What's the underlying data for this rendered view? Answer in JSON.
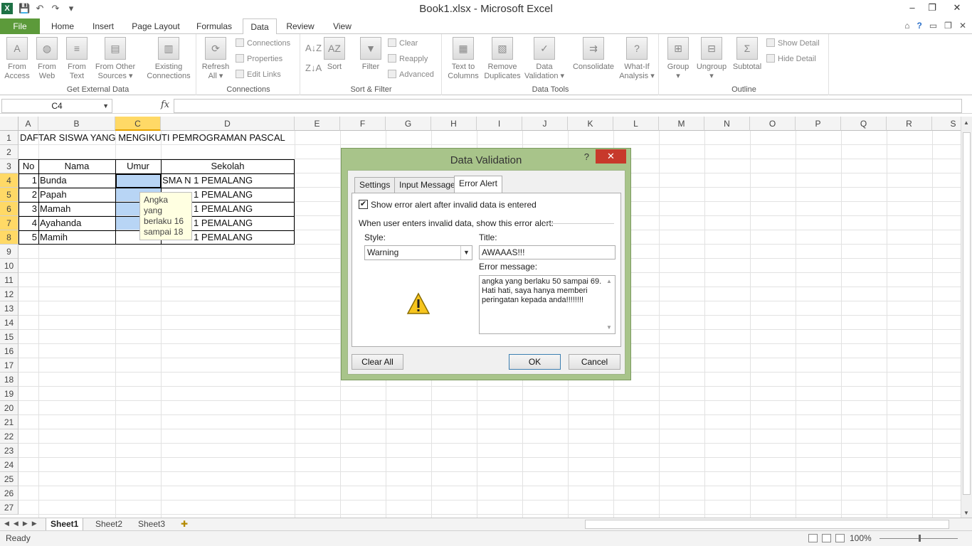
{
  "window": {
    "title": "Book1.xlsx - Microsoft Excel",
    "logo": "X",
    "controls": [
      "–",
      "❐",
      "✕"
    ]
  },
  "qat": [
    "💾",
    "↶",
    "↷",
    "▾"
  ],
  "ribbon_tabs": [
    "File",
    "Home",
    "Insert",
    "Page Layout",
    "Formulas",
    "Data",
    "Review",
    "View"
  ],
  "active_tab": "Data",
  "ribbon_right": [
    "⌂",
    "?",
    "▭",
    "❐",
    "✕"
  ],
  "ribbon": {
    "get_external_data": {
      "label": "Get External Data",
      "buttons": [
        {
          "l1": "From",
          "l2": "Access"
        },
        {
          "l1": "From",
          "l2": "Web"
        },
        {
          "l1": "From",
          "l2": "Text"
        },
        {
          "l1": "From Other",
          "l2": "Sources ▾"
        },
        {
          "l1": "Existing",
          "l2": "Connections"
        }
      ]
    },
    "connections": {
      "label": "Connections",
      "refresh_l1": "Refresh",
      "refresh_l2": "All ▾",
      "items": [
        "Connections",
        "Properties",
        "Edit Links"
      ]
    },
    "sort_filter": {
      "label": "Sort & Filter",
      "sort": "Sort",
      "filter": "Filter",
      "items": [
        "Clear",
        "Reapply",
        "Advanced"
      ]
    },
    "data_tools": {
      "label": "Data Tools",
      "buttons": [
        {
          "l1": "Text to",
          "l2": "Columns"
        },
        {
          "l1": "Remove",
          "l2": "Duplicates"
        },
        {
          "l1": "Data",
          "l2": "Validation ▾"
        },
        {
          "l1": "Consolidate",
          "l2": ""
        },
        {
          "l1": "What-If",
          "l2": "Analysis ▾"
        }
      ]
    },
    "outline": {
      "label": "Outline",
      "buttons": [
        {
          "l1": "Group",
          "l2": "▾"
        },
        {
          "l1": "Ungroup",
          "l2": "▾"
        },
        {
          "l1": "Subtotal",
          "l2": ""
        }
      ],
      "items": [
        "Show Detail",
        "Hide Detail"
      ]
    }
  },
  "formula_bar": {
    "name_box": "C4",
    "fx": "fx",
    "value": ""
  },
  "columns": [
    "A",
    "B",
    "C",
    "D",
    "E",
    "F",
    "G",
    "H",
    "I",
    "J",
    "K",
    "L",
    "M",
    "N",
    "O",
    "P",
    "Q",
    "R",
    "S"
  ],
  "rows": [
    "1",
    "2",
    "3",
    "4",
    "5",
    "6",
    "7",
    "8",
    "9",
    "10",
    "11",
    "12",
    "13",
    "14",
    "15",
    "16",
    "17",
    "18",
    "19",
    "20",
    "21",
    "22",
    "23",
    "24",
    "25",
    "26",
    "27"
  ],
  "sheet": {
    "title": "DAFTAR SISWA YANG MENGIKUTI PEMROGRAMAN PASCAL",
    "headers": {
      "no": "No",
      "nama": "Nama",
      "umur": "Umur",
      "sekolah": "Sekolah"
    },
    "rows": [
      {
        "no": "1",
        "nama": "Bunda",
        "sekolah": "SMA N 1 PEMALANG"
      },
      {
        "no": "2",
        "nama": "Papah",
        "sekolah": "1 PEMALANG"
      },
      {
        "no": "3",
        "nama": "Mamah",
        "sekolah": "1 PEMALANG"
      },
      {
        "no": "4",
        "nama": "Ayahanda",
        "sekolah": "1 PEMALANG"
      },
      {
        "no": "5",
        "nama": "Mamih",
        "sekolah": "SMA N 1 PEMALANG"
      }
    ],
    "input_tooltip": "Angka yang berlaku 16 sampai 18"
  },
  "sheet_tabs": [
    "Sheet1",
    "Sheet2",
    "Sheet3"
  ],
  "active_sheet": "Sheet1",
  "status": {
    "ready": "Ready",
    "zoom": "100%",
    "zoom_fraction": 0.5
  },
  "dialog": {
    "title": "Data Validation",
    "help": "?",
    "close": "✕",
    "tabs": [
      "Settings",
      "Input Message",
      "Error Alert"
    ],
    "active_tab": "Error Alert",
    "show_alert_label": "Show error alert after invalid data is entered",
    "show_alert_checked": true,
    "section_label": "When user enters invalid data, show this error alert:",
    "style_label": "Style:",
    "style_value": "Warning",
    "title_label": "Title:",
    "title_value": "AWAAAS!!!",
    "message_label": "Error message:",
    "message_value": "angka yang berlaku 50 sampai 69.\nHati hati, saya hanya memberi\nperingatan kepada anda!!!!!!!!",
    "clear_all": "Clear All",
    "ok": "OK",
    "cancel": "Cancel"
  }
}
